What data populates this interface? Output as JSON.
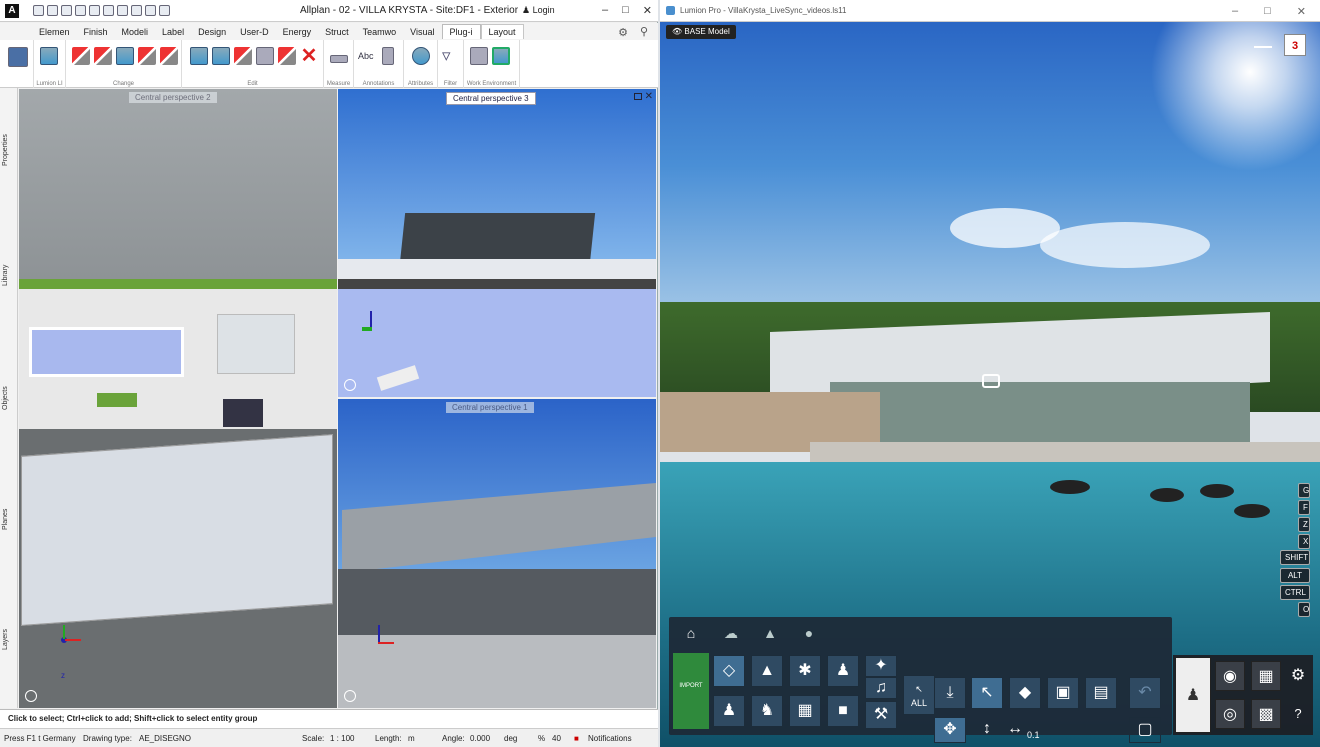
{
  "allplan": {
    "title": "Allplan - 02 - VILLA KRYSTA - Site:DF1 - Exterior",
    "login": "Login",
    "tabs": [
      "Elemen",
      "Finish",
      "Modeli",
      "Label",
      "Design",
      "User-D",
      "Energy",
      "Struct",
      "Teamwo",
      "Visual",
      "Plug-i",
      "Layout"
    ],
    "active_tab": "Plug-i",
    "ribbon_groups": [
      "Lumion LI",
      "Change",
      "Edit",
      "Measure",
      "Annotations",
      "Attributes",
      "Filter",
      "Work Environment"
    ],
    "side_tabs": [
      "Properties",
      "Library",
      "Objects",
      "Planes",
      "Layers"
    ],
    "viewports": {
      "vp_left": "Central perspective 2",
      "vp_top_right": "Central perspective 3",
      "vp_bottom_right": "Central perspective 1"
    },
    "status_hint": "Click to select; Ctrl+click to add; Shift+click to select entity group",
    "statusbar": {
      "help": "Press F1 t Germany",
      "drawing_type_label": "Drawing type:",
      "drawing_type": "AE_DISEGNO",
      "scale_label": "Scale:",
      "scale": "1 : 100",
      "length_label": "Length:",
      "length_unit": "m",
      "angle_label": "Angle:",
      "angle": "0.000",
      "angle_unit": "deg",
      "percent_label": "%",
      "percent": "40",
      "notifications": "Notifications"
    }
  },
  "lumion": {
    "title": "Lumion Pro - VillaKrysta_LiveSync_videos.ls11",
    "model_label": "BASE Model",
    "badge": "3",
    "keys": [
      "G",
      "F",
      "Z",
      "X",
      "SHIFT",
      "ALT",
      "CTRL",
      "O"
    ],
    "import_label": "IMPORT",
    "all_label": "ALL",
    "value_readout": "0.1"
  },
  "colors": {
    "accent_green": "#2f8a3c",
    "panel": "#1e2a38",
    "sky": "#4a8fd6"
  }
}
